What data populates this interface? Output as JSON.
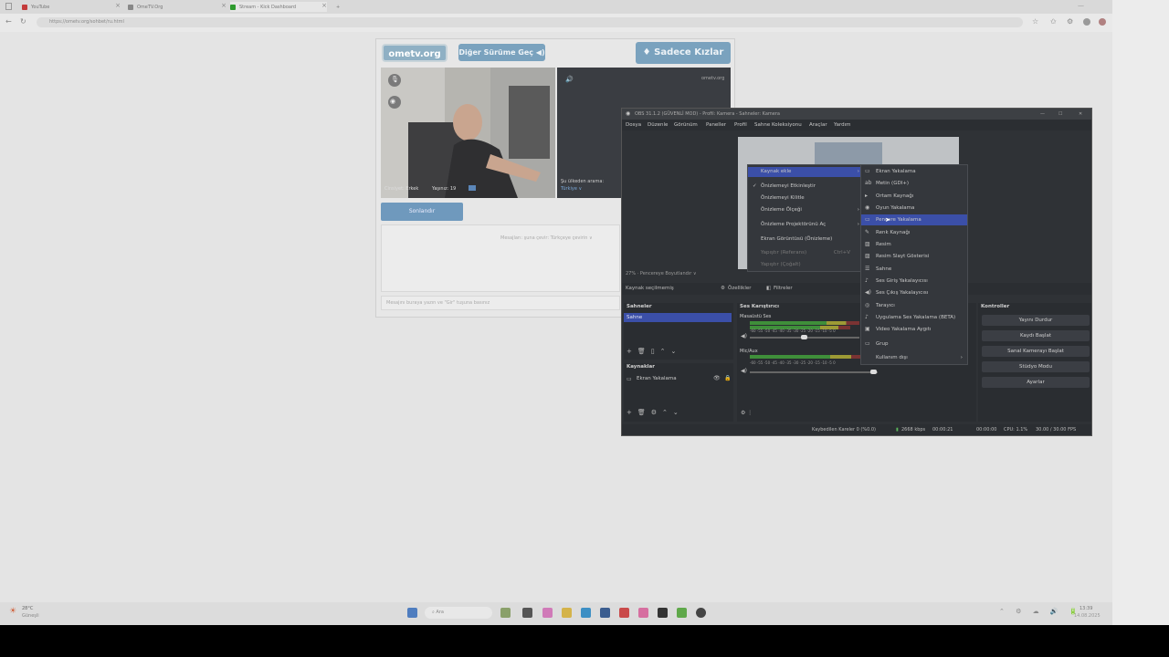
{
  "browser": {
    "tabs": [
      {
        "label": "YouTube",
        "color": "#c43b3b"
      },
      {
        "label": "OmeTV.Org",
        "color": "#888888"
      },
      {
        "label": "Stream - Kick Dashboard",
        "color": "#2e9b2e"
      }
    ],
    "new_tab": "+",
    "url": "https://ometv.org/sohbet/ru.html"
  },
  "ometv": {
    "logo": "ometv.org",
    "other_version_button": "Diğer Sürüme Geç ◀)",
    "girls_only_button": "♦ Sadece Kızlar",
    "local_gender": "Cinsiyet: Erkek",
    "local_age": "Yaşınız: 19",
    "remote_watermark": "ometv.org",
    "country_label": "Şu ülkeden arama:",
    "country_value": "Türkiye ∨",
    "end_button": "Sonlandır",
    "chat_hint": "Mesajları: şuna çevir: Türkçeye çevirin ∨",
    "message_placeholder": "Mesajını buraya yazın ve \"Gir\" tuşuna basınız"
  },
  "obs": {
    "title": "OBS 31.1.2 (GÜVENLİ MOD) - Profil: Kamera - Sahneler: Kamera",
    "menu": [
      "Dosya",
      "Düzenle",
      "Görünüm",
      "Paneller",
      "Profil",
      "Sahne Koleksiyonu",
      "Araçlar",
      "Yardım"
    ],
    "preview_bar": "27%  ·  Pencereye Boyutlandır ∨",
    "no_source": "Kaynak seçilmemiş",
    "properties": "Özellikler",
    "filters": "Filtreler",
    "scenes_header": "Sahneler",
    "scene_item": "Sahne",
    "sources_header": "Kaynaklar",
    "source_item": "Ekran Yakalama",
    "mixer_header": "Ses Karıştırıcı",
    "mixer_track1": "Masaüstü Ses",
    "mixer_track2": "Mic/Aux",
    "mixer_scale": "-60 -55 -50 -45 -40 -35 -30 -25 -20 -15 -10 -5 0",
    "controls_header": "Kontroller",
    "controls": [
      "Yayını Durdur",
      "Kaydı Başlat",
      "Sanal Kamerayı Başlat",
      "Stüdyo Modu",
      "Ayarlar"
    ],
    "status": {
      "dropped": "Kaybedilen Kareler 0 (%0.0)",
      "bitrate": "2668 kbps",
      "time": "00:00:21",
      "rec": "00:00:00",
      "cpu": "CPU: 1.1%",
      "fps": "30.00 / 30.00 FPS"
    },
    "window_controls": [
      "—",
      "☐",
      "✕"
    ]
  },
  "context_menu": {
    "items": [
      {
        "label": "Kaynak ekle",
        "highlight": true,
        "arrow": "›"
      },
      {
        "label": "Önizlemeyi Etkinleştir",
        "check": "✓"
      },
      {
        "label": "Önizlemeyi Kilitle"
      },
      {
        "label": "Önizleme Ölçeği",
        "arrow": "›"
      },
      {
        "label": "Önizleme Projektörünü Aç",
        "arrow": "›"
      },
      {
        "label": "Ekran Görüntüsü (Önizleme)"
      },
      {
        "label": "Yapıştır (Referans)",
        "shortcut": "Ctrl+V",
        "disabled": true
      },
      {
        "label": "Yapıştır (Çoğalt)",
        "disabled": true
      }
    ]
  },
  "add_source_menu": {
    "items": [
      {
        "label": "Ekran Yakalama",
        "glyph": "▭"
      },
      {
        "label": "Metin (GDI+)",
        "glyph": "ab"
      },
      {
        "label": "Ortam Kaynağı",
        "glyph": "▸"
      },
      {
        "label": "Oyun Yakalama",
        "glyph": "◉"
      },
      {
        "label": "Pencere Yakalama",
        "glyph": "▭",
        "highlight": true
      },
      {
        "label": "Renk Kaynağı",
        "glyph": "✎"
      },
      {
        "label": "Resim",
        "glyph": "▨"
      },
      {
        "label": "Resim Slayt Gösterisi",
        "glyph": "▨"
      },
      {
        "label": "Sahne",
        "glyph": "☰"
      },
      {
        "label": "Ses Giriş Yakalayıcısı",
        "glyph": "♪"
      },
      {
        "label": "Ses Çıkış Yakalayıcısı",
        "glyph": "◀)"
      },
      {
        "label": "Tarayıcı",
        "glyph": "◎"
      },
      {
        "label": "Uygulama Ses Yakalama (BETA)",
        "glyph": "♪"
      },
      {
        "label": "Video Yakalama Aygıtı",
        "glyph": "▣"
      },
      {
        "label": "Grup",
        "glyph": "▭"
      },
      {
        "label": "Kullanım dışı",
        "glyph": "",
        "arrow": "›"
      }
    ]
  },
  "taskbar": {
    "weather_temp": "28°C",
    "weather_desc": "Güneşli",
    "search": "Ara",
    "time": "13:39",
    "date": "14.08.2025"
  }
}
